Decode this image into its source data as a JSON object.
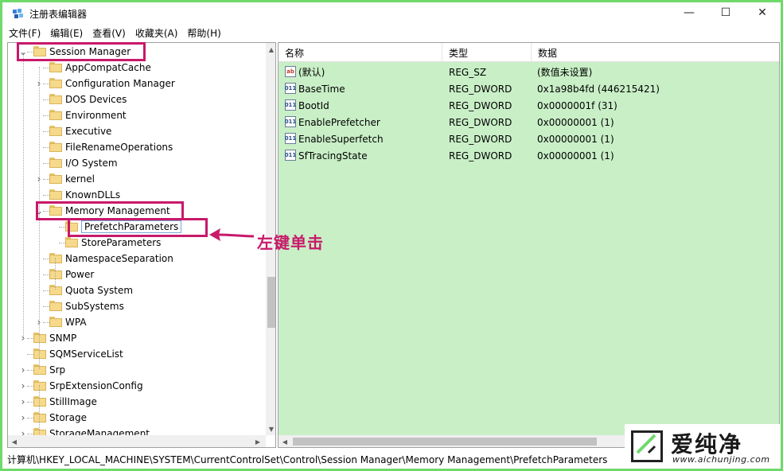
{
  "window": {
    "title": "注册表编辑器",
    "min": "—",
    "max": "☐",
    "close": "✕"
  },
  "menu": [
    "文件(F)",
    "编辑(E)",
    "查看(V)",
    "收藏夹(A)",
    "帮助(H)"
  ],
  "tree": {
    "items": [
      {
        "label": "Session Manager",
        "expanded": true
      },
      {
        "label": "AppCompatCache"
      },
      {
        "label": "Configuration Manager",
        "expandable": true
      },
      {
        "label": "DOS Devices"
      },
      {
        "label": "Environment"
      },
      {
        "label": "Executive"
      },
      {
        "label": "FileRenameOperations"
      },
      {
        "label": "I/O System"
      },
      {
        "label": "kernel",
        "expandable": true
      },
      {
        "label": "KnownDLLs"
      },
      {
        "label": "Memory Management",
        "expanded": true
      },
      {
        "label": "PrefetchParameters",
        "selected": true
      },
      {
        "label": "StoreParameters"
      },
      {
        "label": "NamespaceSeparation"
      },
      {
        "label": "Power"
      },
      {
        "label": "Quota System"
      },
      {
        "label": "SubSystems"
      },
      {
        "label": "WPA",
        "expandable": true
      },
      {
        "label": "SNMP",
        "expandable": true
      },
      {
        "label": "SQMServiceList"
      },
      {
        "label": "Srp",
        "expandable": true
      },
      {
        "label": "SrpExtensionConfig",
        "expandable": true
      },
      {
        "label": "StillImage",
        "expandable": true
      },
      {
        "label": "Storage",
        "expandable": true
      },
      {
        "label": "StorageManagement",
        "expandable": true
      }
    ]
  },
  "list": {
    "headers": {
      "name": "名称",
      "type": "类型",
      "data": "数据"
    },
    "rows": [
      {
        "icon": "ab",
        "name": "(默认)",
        "type": "REG_SZ",
        "data": "(数值未设置)"
      },
      {
        "icon": "bin",
        "name": "BaseTime",
        "type": "REG_DWORD",
        "data": "0x1a98b4fd (446215421)"
      },
      {
        "icon": "bin",
        "name": "BootId",
        "type": "REG_DWORD",
        "data": "0x0000001f (31)"
      },
      {
        "icon": "bin",
        "name": "EnablePrefetcher",
        "type": "REG_DWORD",
        "data": "0x00000001 (1)"
      },
      {
        "icon": "bin",
        "name": "EnableSuperfetch",
        "type": "REG_DWORD",
        "data": "0x00000001 (1)"
      },
      {
        "icon": "bin",
        "name": "SfTracingState",
        "type": "REG_DWORD",
        "data": "0x00000001 (1)"
      }
    ]
  },
  "status": {
    "path": "计算机\\HKEY_LOCAL_MACHINE\\SYSTEM\\CurrentControlSet\\Control\\Session Manager\\Memory Management\\PrefetchParameters"
  },
  "annotation": {
    "text": "左键单击"
  },
  "watermark": {
    "brand": "爱纯净",
    "url": "www.aichunjing.com"
  },
  "colors": {
    "frame": "#6fd96a",
    "highlight": "#c8196a",
    "list_bg": "#c9efc7"
  }
}
